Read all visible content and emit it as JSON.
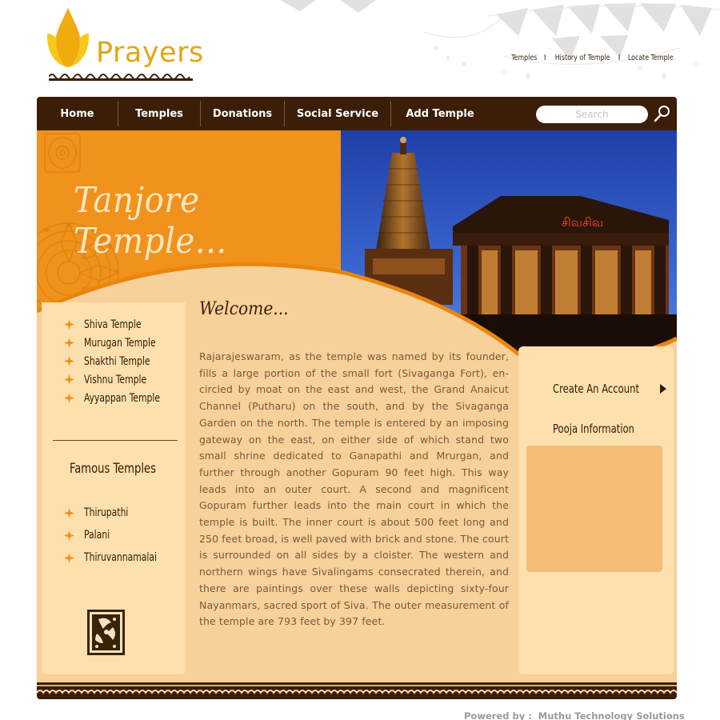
{
  "brand": {
    "name": "Prayers"
  },
  "top_links": [
    "Temples",
    "History of Temple",
    "Locate Temple"
  ],
  "top_links_separator": "I",
  "nav": {
    "items": [
      "Home",
      "Temples",
      "Donations",
      "Social Service",
      "Add Temple"
    ],
    "search_placeholder": "Search"
  },
  "hero": {
    "title": "Tanjore Temple...",
    "sign_text": "சிவசிவ"
  },
  "sidebar": {
    "temples": [
      "Shiva Temple",
      "Murugan Temple",
      "Shakthi Temple",
      "Vishnu Temple",
      "Ayyappan Temple"
    ],
    "famous_title": "Famous Temples",
    "famous": [
      "Thirupathi",
      "Palani",
      "Thiruvannamalai"
    ]
  },
  "content": {
    "heading": "Welcome...",
    "body": "Rajarajeswaram, as the temple was named by its founder, fills a large portion of the small fort (Sivaganga Fort), en-circled by moat on the east and west, the Grand Anaicut Channel (Putharu) on the south, and by the Sivaganga Garden on the north. The temple is entered by an imposing gateway on the east, on either side of which stand two small shrine dedicated to Ganapathi and Mrurgan, and further through another Gopuram 90 feet high. This way leads into an outer court. A second and magnificent Gopuram further leads into the main court in which the temple is built. The inner court is about 500 feet long and 250 feet broad, is well paved with brick and stone. The court is surrounded on all sides by a cloister. The western and northern wings have Sivalingams consecrated therein, and there are paintings over these walls depicting sixty-four Nayanmars, sacred sport of Siva. The outer measurement of the temple are 793 feet by 397 feet."
  },
  "right": {
    "create_account": "Create An Account",
    "pooja_title": "Pooja Information"
  },
  "footer": {
    "powered_label": "Powered by :",
    "company": "Muthu Technology Solutions"
  },
  "colors": {
    "orange": "#f0921b",
    "brown": "#3b1e08",
    "cream": "#fde0ad",
    "peach": "#f7d09a",
    "gold": "#e2a514"
  }
}
